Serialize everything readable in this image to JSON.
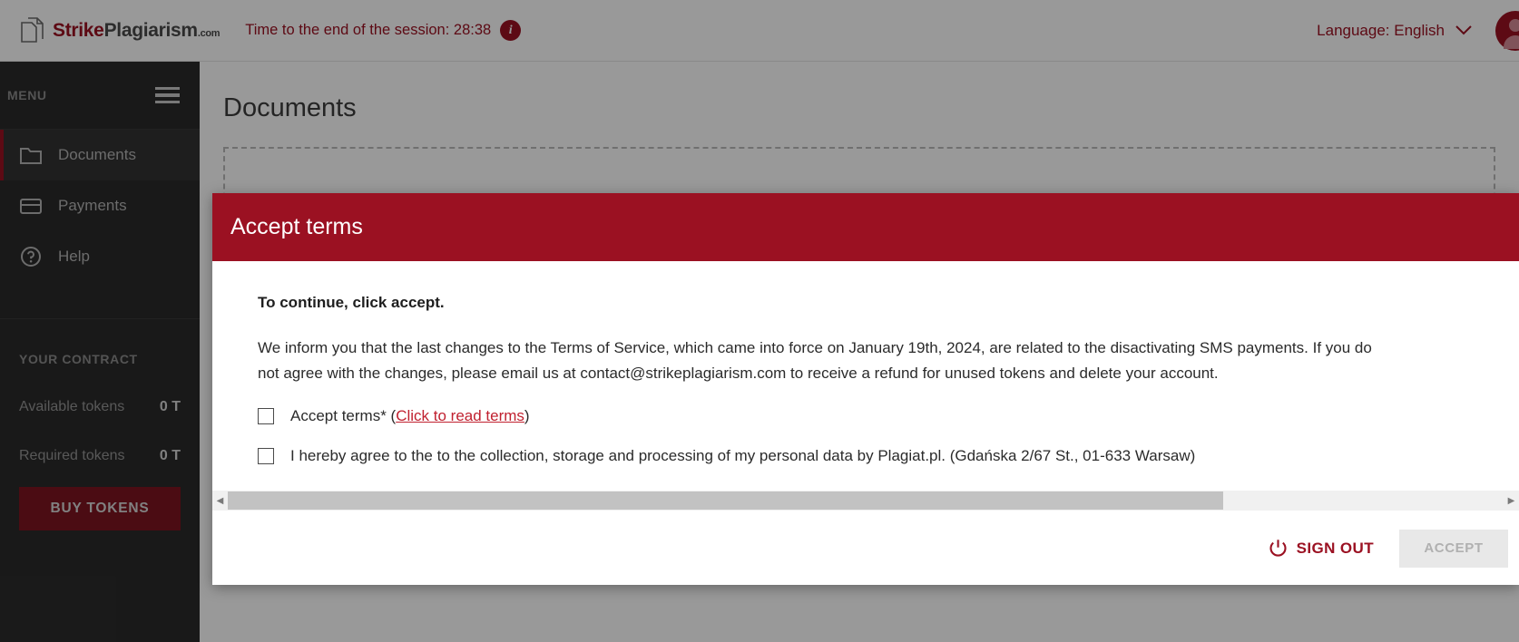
{
  "header": {
    "logo": {
      "part1": "Strike",
      "part2": "Plagiarism",
      "part3": ".com",
      "icon": "document-stack-icon"
    },
    "session_text": "Time to the end of the session: 28:38",
    "info_badge": "i",
    "language_label": "Language: English",
    "chevron": "⌄"
  },
  "sidebar": {
    "menu_label": "MENU",
    "items": [
      {
        "label": "Documents",
        "icon": "folder-icon",
        "active": true
      },
      {
        "label": "Payments",
        "icon": "credit-card-icon",
        "active": false
      },
      {
        "label": "Help",
        "icon": "question-circle-icon",
        "active": false
      }
    ],
    "contract_title": "YOUR CONTRACT",
    "tokens": [
      {
        "label": "Available tokens",
        "value": "0 T"
      },
      {
        "label": "Required tokens",
        "value": "0 T"
      }
    ],
    "buy_button": "BUY TOKENS"
  },
  "main": {
    "page_title": "Documents"
  },
  "modal": {
    "title": "Accept terms",
    "lead": "To continue, click accept.",
    "paragraph": "We inform you that the last changes to the Terms of Service, which came into force on January 19th, 2024, are related to the disactivating SMS payments. If you do not agree with the changes, please email us at contact@strikeplagiarism.com to receive a refund for unused tokens and delete your account.",
    "checkbox1": {
      "prefix": "Accept terms* (",
      "link": "Click to read terms",
      "suffix": ")",
      "checked": false
    },
    "checkbox2": {
      "label": "I hereby agree to the to the collection, storage and processing of my personal data by Plagiat.pl. (Gdańska 2/67 St., 01-633 Warsaw)",
      "checked": false
    },
    "scrollbar": {
      "left_arrow": "◀",
      "right_arrow": "▶",
      "thumb_percent": 78
    },
    "signout_label": "SIGN OUT",
    "signout_icon": "power-icon",
    "accept_label": "ACCEPT"
  },
  "colors": {
    "brand_red": "#9B1122",
    "link_red": "#c0202f",
    "sidebar_bg": "#2b2b2b",
    "buy_btn": "#7d1420"
  }
}
